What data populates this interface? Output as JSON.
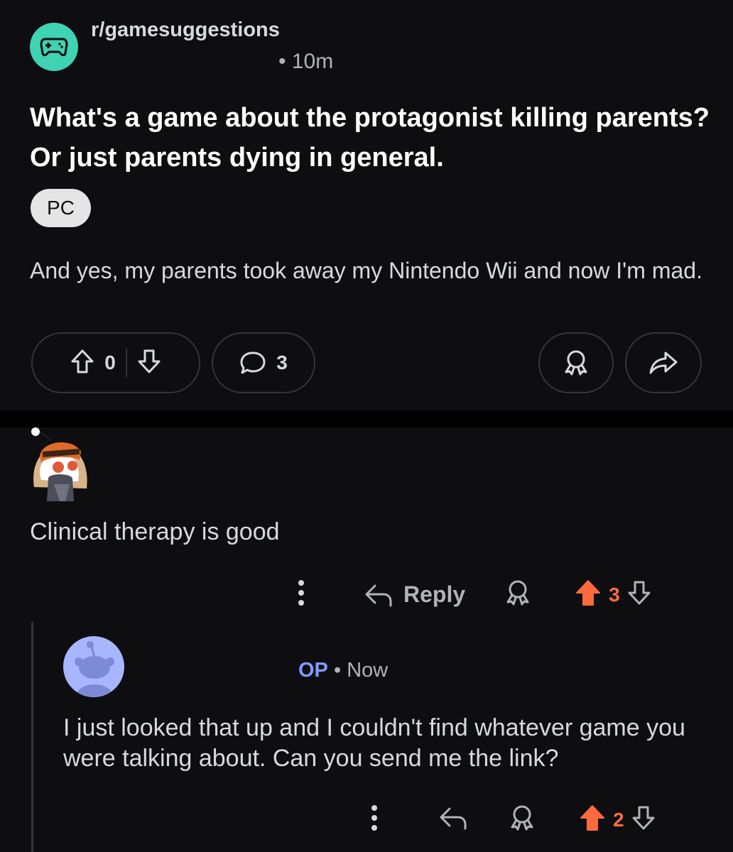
{
  "post": {
    "subreddit": "r/gamesuggestions",
    "timestamp": "• 10m",
    "title": "What's a game about the protagonist killing parents? Or just parents dying in general.",
    "flair": "PC",
    "body": "And yes, my parents took away my Nintendo Wii and now I'm mad.",
    "vote_count": "0",
    "comment_count": "3",
    "icons": {
      "subreddit": "gamepad-icon",
      "upvote": "arrow-up-outline-icon",
      "downvote": "arrow-down-outline-icon",
      "comment": "speech-bubble-icon",
      "award": "award-icon",
      "share": "share-arrow-icon"
    }
  },
  "comments": [
    {
      "text": "Clinical therapy is good",
      "reply_label": "Reply",
      "score": "3",
      "upvoted": true
    },
    {
      "author": "OP",
      "separator": "•",
      "timestamp": "Now",
      "text": "I just looked that up and I couldn't find whatever game you were talking about. Can you send me the link?",
      "score": "2",
      "upvoted": true
    }
  ],
  "colors": {
    "background": "#0e0e10",
    "text": "#d7dadc",
    "muted": "#b0b3b8",
    "upvote": "#ff6a3d",
    "op": "#7f9aff",
    "subreddit_icon": "#3fd2b3"
  }
}
